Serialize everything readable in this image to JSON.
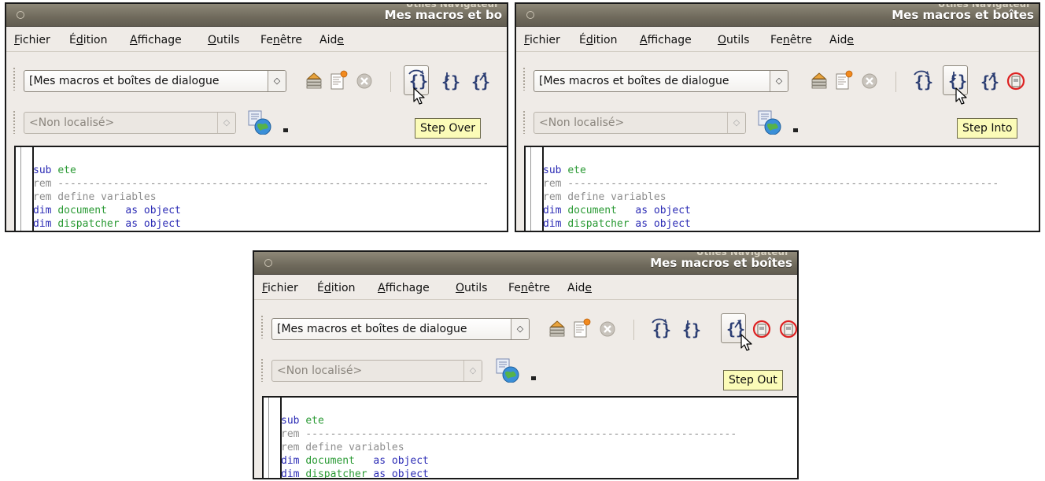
{
  "colors": {
    "keyword": "#2b2bb5",
    "identifier": "#2a9a34",
    "comment": "#8e8e8e",
    "tooltip_bg": "#fbfbb8",
    "titlebar": "#6f6a5c"
  },
  "panels": [
    {
      "title": "Mes macros et bo",
      "title_ghost": "Utiles   Navigateur",
      "menu": [
        "Fichier",
        "Édition",
        "Affichage",
        "Outils",
        "Fenêtre",
        "Aide"
      ],
      "library_combo": "[Mes macros et boîtes de dialogue",
      "language_combo": "<Non localisé>",
      "tooltip": "Step Over",
      "code": {
        "line1_kw": "sub",
        "line1_id": "ete",
        "line2": "rem ----------------------------------------------------------------------",
        "line3": "rem define variables",
        "line4_kw": "dim",
        "line4_id": "document",
        "line4_rest": "as object",
        "line5_kw": "dim",
        "line5_id": "dispatcher",
        "line5_rest": "as object"
      }
    },
    {
      "title": "Mes macros et boîtes",
      "title_ghost": "Utiles   Navigateur",
      "menu": [
        "Fichier",
        "Édition",
        "Affichage",
        "Outils",
        "Fenêtre",
        "Aide"
      ],
      "library_combo": "[Mes macros et boîtes de dialogue",
      "language_combo": "<Non localisé>",
      "tooltip": "Step Into",
      "code": {
        "line1_kw": "sub",
        "line1_id": "ete",
        "line2": "rem ----------------------------------------------------------------------",
        "line3": "rem define variables",
        "line4_kw": "dim",
        "line4_id": "document",
        "line4_rest": "as object",
        "line5_kw": "dim",
        "line5_id": "dispatcher",
        "line5_rest": "as object"
      }
    },
    {
      "title": "Mes macros et boîtes",
      "title_ghost": "Utiles   Navigateur",
      "menu": [
        "Fichier",
        "Édition",
        "Affichage",
        "Outils",
        "Fenêtre",
        "Aide"
      ],
      "library_combo": "[Mes macros et boîtes de dialogue",
      "language_combo": "<Non localisé>",
      "tooltip": "Step Out",
      "code": {
        "line1_kw": "sub",
        "line1_id": "ete",
        "line2": "rem ----------------------------------------------------------------------",
        "line3": "rem define variables",
        "line4_kw": "dim",
        "line4_id": "document",
        "line4_rest": "as object",
        "line5_kw": "dim",
        "line5_id": "dispatcher",
        "line5_rest": "as object"
      }
    }
  ]
}
